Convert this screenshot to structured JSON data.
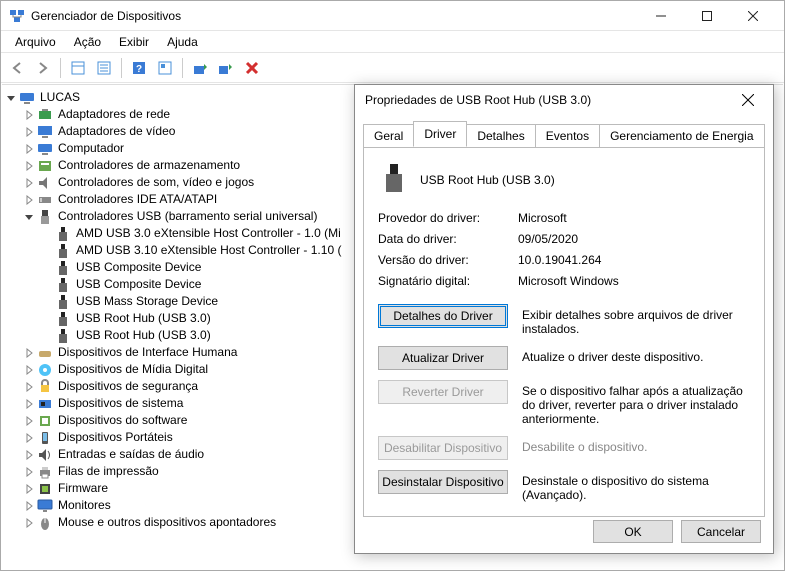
{
  "window": {
    "title": "Gerenciador de Dispositivos",
    "buttons": {
      "min": "—",
      "max": "▢",
      "close": "✕"
    }
  },
  "menu": {
    "arquivo": "Arquivo",
    "acao": "Ação",
    "exibir": "Exibir",
    "ajuda": "Ajuda"
  },
  "tree": {
    "root": "LUCAS",
    "items": [
      {
        "label": "Adaptadores de rede",
        "expanded": false,
        "icon": "net"
      },
      {
        "label": "Adaptadores de vídeo",
        "expanded": false,
        "icon": "display"
      },
      {
        "label": "Computador",
        "expanded": false,
        "icon": "computer"
      },
      {
        "label": "Controladores de armazenamento",
        "expanded": false,
        "icon": "storage"
      },
      {
        "label": "Controladores de som, vídeo e jogos",
        "expanded": false,
        "icon": "sound"
      },
      {
        "label": "Controladores IDE ATA/ATAPI",
        "expanded": false,
        "icon": "ide"
      },
      {
        "label": "Controladores USB (barramento serial universal)",
        "expanded": true,
        "icon": "usb",
        "children": [
          {
            "label": "AMD USB 3.0 eXtensible Host Controller - 1.0 (Mi",
            "icon": "usb-dev"
          },
          {
            "label": "AMD USB 3.10 eXtensible Host Controller - 1.10 (",
            "icon": "usb-dev"
          },
          {
            "label": "USB Composite Device",
            "icon": "usb-dev"
          },
          {
            "label": "USB Composite Device",
            "icon": "usb-dev"
          },
          {
            "label": "USB Mass Storage Device",
            "icon": "usb-dev"
          },
          {
            "label": "USB Root Hub (USB 3.0)",
            "icon": "usb-dev"
          },
          {
            "label": "USB Root Hub (USB 3.0)",
            "icon": "usb-dev"
          }
        ]
      },
      {
        "label": "Dispositivos de Interface Humana",
        "expanded": false,
        "icon": "hid"
      },
      {
        "label": "Dispositivos de Mídia Digital",
        "expanded": false,
        "icon": "media"
      },
      {
        "label": "Dispositivos de segurança",
        "expanded": false,
        "icon": "security"
      },
      {
        "label": "Dispositivos de sistema",
        "expanded": false,
        "icon": "system"
      },
      {
        "label": "Dispositivos do software",
        "expanded": false,
        "icon": "software"
      },
      {
        "label": "Dispositivos Portáteis",
        "expanded": false,
        "icon": "portable"
      },
      {
        "label": "Entradas e saídas de áudio",
        "expanded": false,
        "icon": "audio"
      },
      {
        "label": "Filas de impressão",
        "expanded": false,
        "icon": "printer"
      },
      {
        "label": "Firmware",
        "expanded": false,
        "icon": "firmware"
      },
      {
        "label": "Monitores",
        "expanded": false,
        "icon": "monitor"
      },
      {
        "label": "Mouse e outros dispositivos apontadores",
        "expanded": false,
        "icon": "mouse"
      }
    ]
  },
  "dialog": {
    "title": "Propriedades de USB Root Hub (USB 3.0)",
    "tabs": {
      "geral": "Geral",
      "driver": "Driver",
      "detalhes": "Detalhes",
      "eventos": "Eventos",
      "energia": "Gerenciamento de Energia"
    },
    "device_name": "USB Root Hub (USB 3.0)",
    "info": {
      "provider_label": "Provedor do driver:",
      "provider_value": "Microsoft",
      "date_label": "Data do driver:",
      "date_value": "09/05/2020",
      "version_label": "Versão do driver:",
      "version_value": "10.0.19041.264",
      "signer_label": "Signatário digital:",
      "signer_value": "Microsoft Windows"
    },
    "actions": {
      "details_btn": "Detalhes do Driver",
      "details_desc": "Exibir detalhes sobre arquivos de driver instalados.",
      "update_btn": "Atualizar Driver",
      "update_desc": "Atualize o driver deste dispositivo.",
      "rollback_btn": "Reverter Driver",
      "rollback_desc": "Se o dispositivo falhar após a atualização do driver, reverter para o driver instalado anteriormente.",
      "disable_btn": "Desabilitar Dispositivo",
      "disable_desc": "Desabilite o dispositivo.",
      "uninstall_btn": "Desinstalar Dispositivo",
      "uninstall_desc": "Desinstale o dispositivo do sistema (Avançado)."
    },
    "ok": "OK",
    "cancel": "Cancelar"
  }
}
